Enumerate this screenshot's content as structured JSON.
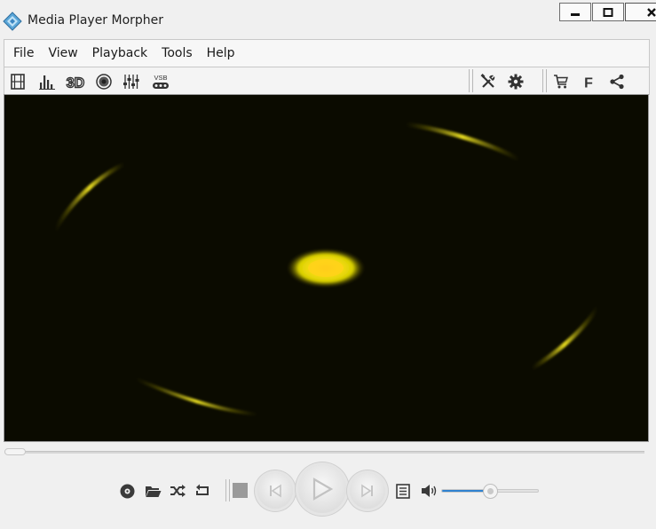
{
  "window": {
    "title": "Media Player Morpher"
  },
  "menu": [
    "File",
    "View",
    "Playback",
    "Tools",
    "Help"
  ],
  "toolbar_left": [
    {
      "icon": "film-icon"
    },
    {
      "icon": "spectrum-icon"
    },
    {
      "icon": "3d-icon",
      "text": "3D"
    },
    {
      "icon": "speaker-icon"
    },
    {
      "icon": "equalizer-icon"
    },
    {
      "icon": "vsb-icon",
      "text": "VSB"
    }
  ],
  "toolbar_right": [
    {
      "icon": "tools-icon"
    },
    {
      "icon": "gear-icon"
    },
    {
      "icon": "cart-icon"
    },
    {
      "icon": "facebook-icon",
      "text": "F"
    },
    {
      "icon": "share-icon"
    }
  ],
  "playback": {
    "seek_fraction": 0.0,
    "volume_fraction": 0.5
  },
  "colors": {
    "accent": "#2f82d0",
    "video_bg": "#0b0b00",
    "glow": "#e8e000"
  }
}
